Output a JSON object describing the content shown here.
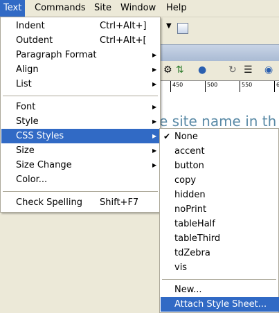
{
  "menubar": {
    "items": [
      {
        "label": "Text",
        "active": true
      },
      {
        "label": "Commands"
      },
      {
        "label": "Site"
      },
      {
        "label": "Window"
      },
      {
        "label": "Help"
      }
    ]
  },
  "background": {
    "ruler_labels": [
      "450",
      "500",
      "550",
      "6"
    ],
    "canvas_text": "e site name in th"
  },
  "text_menu": {
    "groups": [
      [
        {
          "label": "Indent",
          "shortcut": "Ctrl+Alt+]"
        },
        {
          "label": "Outdent",
          "shortcut": "Ctrl+Alt+["
        },
        {
          "label": "Paragraph Format",
          "submenu": true
        },
        {
          "label": "Align",
          "submenu": true
        },
        {
          "label": "List",
          "submenu": true
        }
      ],
      [
        {
          "label": "Font",
          "submenu": true
        },
        {
          "label": "Style",
          "submenu": true
        },
        {
          "label": "CSS Styles",
          "submenu": true,
          "highlighted": true
        },
        {
          "label": "Size",
          "submenu": true
        },
        {
          "label": "Size Change",
          "submenu": true
        },
        {
          "label": "Color..."
        }
      ],
      [
        {
          "label": "Check Spelling",
          "shortcut": "Shift+F7"
        }
      ]
    ]
  },
  "css_styles_submenu": {
    "items": [
      {
        "label": "None",
        "checked": true
      },
      {
        "label": "accent"
      },
      {
        "label": "button"
      },
      {
        "label": "copy"
      },
      {
        "label": "hidden"
      },
      {
        "label": "noPrint"
      },
      {
        "label": "tableHalf"
      },
      {
        "label": "tableThird"
      },
      {
        "label": "tdZebra"
      },
      {
        "label": "vis"
      }
    ],
    "footer_items": [
      {
        "label": "New..."
      },
      {
        "label": "Attach Style Sheet...",
        "highlighted": true
      }
    ]
  },
  "colors": {
    "highlight": "#316ac5",
    "menu_bg": "#ffffff",
    "chrome_bg": "#ece9d8"
  }
}
